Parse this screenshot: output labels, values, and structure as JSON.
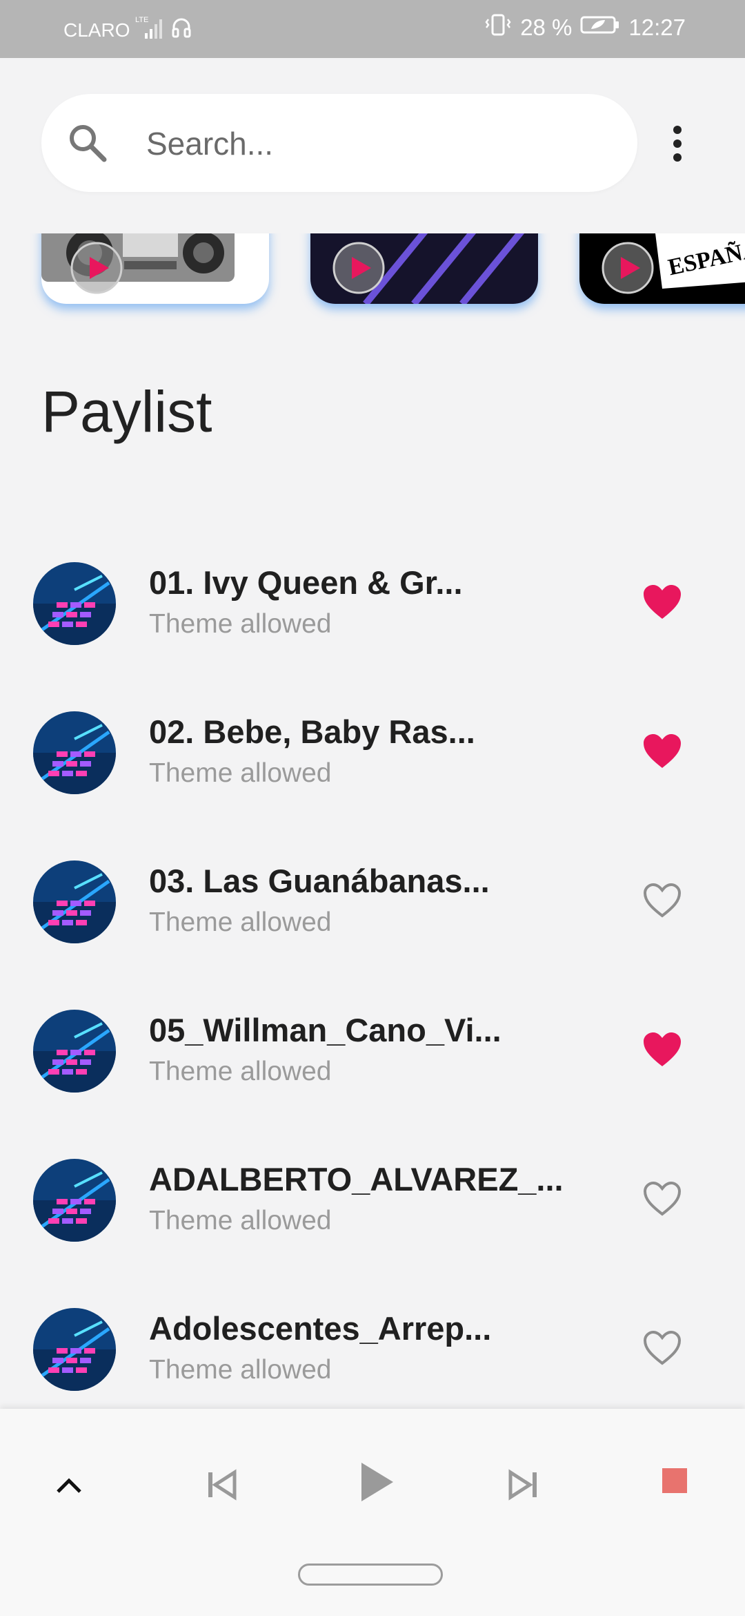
{
  "status_bar": {
    "carrier": "CLARO",
    "network": "LTE",
    "battery": "28 %",
    "time": "12:27"
  },
  "search": {
    "placeholder": "Search..."
  },
  "playlist": {
    "title": "Paylist",
    "tracks": [
      {
        "title": "01. Ivy Queen & Gr...",
        "subtitle": "Theme allowed",
        "favorite": true
      },
      {
        "title": "02. Bebe, Baby Ras...",
        "subtitle": "Theme allowed",
        "favorite": true
      },
      {
        "title": "03. Las Guanábanas...",
        "subtitle": "Theme allowed",
        "favorite": false
      },
      {
        "title": "05_Willman_Cano_Vi...",
        "subtitle": "Theme allowed",
        "favorite": true
      },
      {
        "title": "ADALBERTO_ALVAREZ_...",
        "subtitle": "Theme allowed",
        "favorite": false
      },
      {
        "title": "Adolescentes_Arrep...",
        "subtitle": "Theme allowed",
        "favorite": false
      }
    ]
  },
  "colors": {
    "accent": "#e8175d",
    "stop": "#e8736e",
    "status_bar": "#b5b5b5",
    "background": "#f3f3f4"
  },
  "icons": {
    "search": "search-icon",
    "more": "more-vert-icon",
    "favorite_on": "heart-filled-icon",
    "favorite_off": "heart-outline-icon",
    "expand": "chevron-up-icon",
    "previous": "skip-previous-icon",
    "play": "play-icon",
    "next": "skip-next-icon",
    "stop": "stop-icon"
  }
}
